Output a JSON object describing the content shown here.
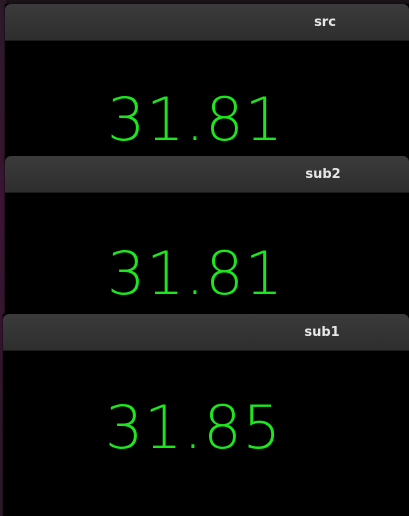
{
  "windows": [
    {
      "title": "src",
      "reading": "31.81"
    },
    {
      "title": "sub2",
      "reading": "31.81"
    },
    {
      "title": "sub1",
      "reading": "31.85"
    }
  ],
  "colors": {
    "reading": "#1ee61e",
    "background": "#000000",
    "titlebar": "#333333",
    "title_text": "#e6e6e6"
  }
}
